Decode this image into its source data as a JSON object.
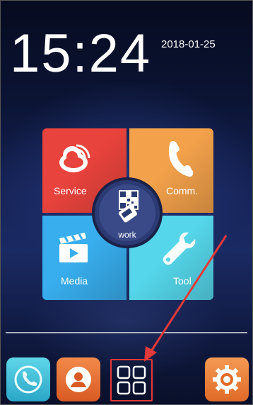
{
  "status": {
    "time": "15:24",
    "date": "2018-01-25"
  },
  "tiles": {
    "service": {
      "label": "Service",
      "icon": "cloud-icon",
      "color": "#e8433c"
    },
    "comm": {
      "label": "Comm.",
      "icon": "phone-handset-icon",
      "color": "#f3a14a"
    },
    "media": {
      "label": "Media",
      "icon": "clapperboard-icon",
      "color": "#38aeee"
    },
    "tool": {
      "label": "Tool",
      "icon": "wrench-icon",
      "color": "#55d6ea"
    }
  },
  "center_button": {
    "label": "work",
    "icon": "qr-scan-icon"
  },
  "dock": {
    "items": [
      {
        "name": "phone",
        "icon": "phone-icon"
      },
      {
        "name": "contacts",
        "icon": "person-icon"
      },
      {
        "name": "apps",
        "icon": "app-grid-icon",
        "highlighted": true
      },
      {
        "name": "settings",
        "icon": "gear-icon"
      }
    ]
  },
  "annotation": {
    "arrow_color": "#e23a3a"
  }
}
